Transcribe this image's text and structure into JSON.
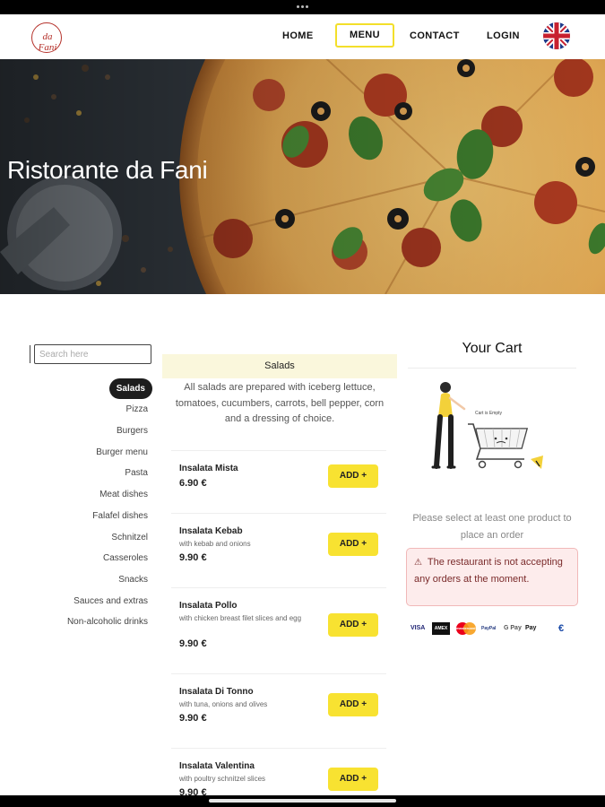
{
  "nav": {
    "logo_text": "da Fani",
    "home": "HOME",
    "menu": "MENU",
    "contact": "CONTACT",
    "login": "LOGIN"
  },
  "hero": {
    "title": "Ristorante da Fani"
  },
  "search": {
    "placeholder": "Search here"
  },
  "categories": [
    "Salads",
    "Pizza",
    "Burgers",
    "Burger menu",
    "Pasta",
    "Meat dishes",
    "Falafel dishes",
    "Schnitzel",
    "Casseroles",
    "Snacks",
    "Sauces and extras",
    "Non-alcoholic drinks"
  ],
  "active_category": "Salads",
  "section": {
    "title": "Salads",
    "description": "All salads are prepared with iceberg lettuce, tomatoes, cucumbers, carrots, bell pepper, corn and a dressing of choice."
  },
  "items": [
    {
      "name": "Insalata Mista",
      "description": "",
      "price": "6.90 €"
    },
    {
      "name": "Insalata Kebab",
      "description": "with kebab and onions",
      "price": "9.90 €"
    },
    {
      "name": "Insalata Pollo",
      "description": "with chicken breast filet slices and egg",
      "price": "9.90 €"
    },
    {
      "name": "Insalata Di Tonno",
      "description": "with tuna, onions and olives",
      "price": "9.90 €"
    },
    {
      "name": "Insalata Valentina",
      "description": "with poultry schnitzel slices",
      "price": "9.90 €"
    }
  ],
  "add_label": "ADD +",
  "cart": {
    "title": "Your Cart",
    "illustration_label": "Cart is Empty",
    "message": "Please select at least one product to place an order",
    "alert": "The restaurant is not accepting any orders at the moment.",
    "payments": [
      "VISA",
      "AMEX",
      "mastercard",
      "PayPal",
      "G Pay",
      "Pay",
      "€"
    ]
  },
  "colors": {
    "accent": "#f8e231",
    "section_bg": "#faf7dc",
    "alert_bg": "#fdecec",
    "logo": "#b5322b"
  }
}
